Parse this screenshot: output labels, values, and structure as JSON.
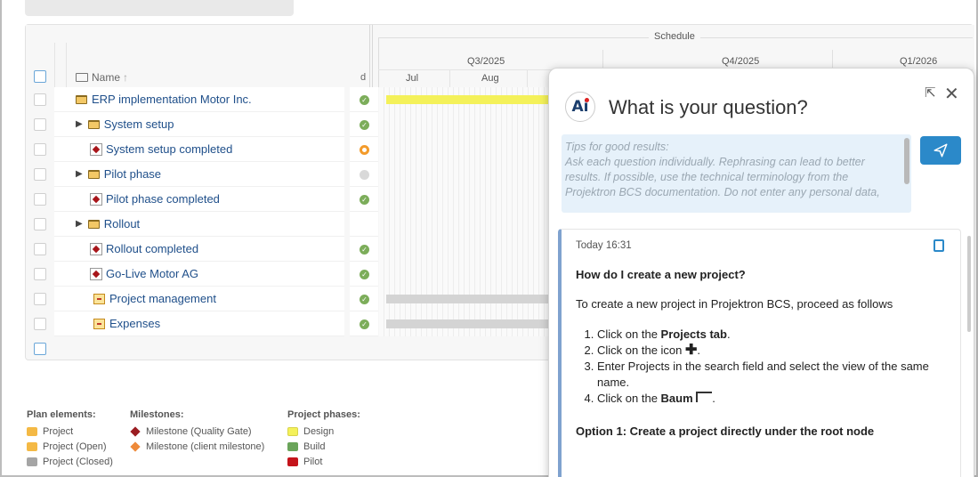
{
  "gantt": {
    "name_header": "Name",
    "d_header": "d",
    "schedule_label": "Schedule",
    "quarters": [
      "Q3/2025",
      "Q4/2025",
      "Q1/2026"
    ],
    "months": [
      "Jul",
      "Aug"
    ],
    "rows": [
      {
        "label": "ERP implementation Motor Inc.",
        "icon": "folder-icon",
        "expand": false,
        "status": "ok"
      },
      {
        "label": "System setup",
        "icon": "folder-icon",
        "expand": true,
        "status": "ok"
      },
      {
        "label": "System setup completed",
        "icon": "milestone-icon",
        "expand": false,
        "status": "warn"
      },
      {
        "label": "Pilot phase",
        "icon": "folder-icon",
        "expand": true,
        "status": "none"
      },
      {
        "label": "Pilot phase completed",
        "icon": "milestone-icon",
        "expand": false,
        "status": "ok"
      },
      {
        "label": "Rollout",
        "icon": "folder-icon",
        "expand": true,
        "status": ""
      },
      {
        "label": "Rollout completed",
        "icon": "milestone-icon",
        "expand": false,
        "status": "ok"
      },
      {
        "label": "Go-Live Motor AG",
        "icon": "milestone-icon",
        "expand": false,
        "status": "ok"
      },
      {
        "label": "Project management",
        "icon": "task-icon",
        "expand": false,
        "status": "ok"
      },
      {
        "label": "Expenses",
        "icon": "task-icon",
        "expand": false,
        "status": "ok"
      }
    ],
    "bar_colors": {
      "yellow": "#f4f15a",
      "gray": "#d4d4d4"
    }
  },
  "legend": {
    "plan_title": "Plan elements:",
    "plan_items": [
      {
        "label": "Project",
        "color": "#f4b945"
      },
      {
        "label": "Project (Open)",
        "color": "#f4b945"
      },
      {
        "label": "Project (Closed)",
        "color": "#a5a5a5"
      }
    ],
    "milestone_title": "Milestones:",
    "milestone_items": [
      {
        "label": "Milestone (Quality Gate)",
        "color": "#9b1d22"
      },
      {
        "label": "Milestone (client milestone)",
        "color": "#ee8a3a"
      }
    ],
    "phase_title": "Project phases:",
    "phase_items": [
      {
        "label": "Design",
        "color": "#f4f15a"
      },
      {
        "label": "Build",
        "color": "#6aa45a"
      },
      {
        "label": "Pilot",
        "color": "#c4141b"
      }
    ]
  },
  "assistant": {
    "logo_text": "Ai",
    "title": "What is your question?",
    "placeholder_lines": [
      "Tips for good results:",
      "Ask each question individually. Rephrasing can lead to better",
      "results. If possible, use the technical terminology from the",
      "Projektron BCS documentation. Do not enter any personal data,"
    ],
    "answer": {
      "time": "Today 16:31",
      "question": "How do I create a new project?",
      "intro": "To create a new project in Projektron BCS, proceed as follows",
      "step1_pre": "Click on the ",
      "step1_bold": "Projects tab",
      "step1_post": ".",
      "step2": "Click on the icon",
      "step2_post": ".",
      "step3": "Enter Projects in the search field and select the view of the same name.",
      "step4_pre": "Click on the ",
      "step4_bold": "Baum",
      "step4_post": ".",
      "option1": "Option 1: Create a project directly under the root node"
    }
  }
}
